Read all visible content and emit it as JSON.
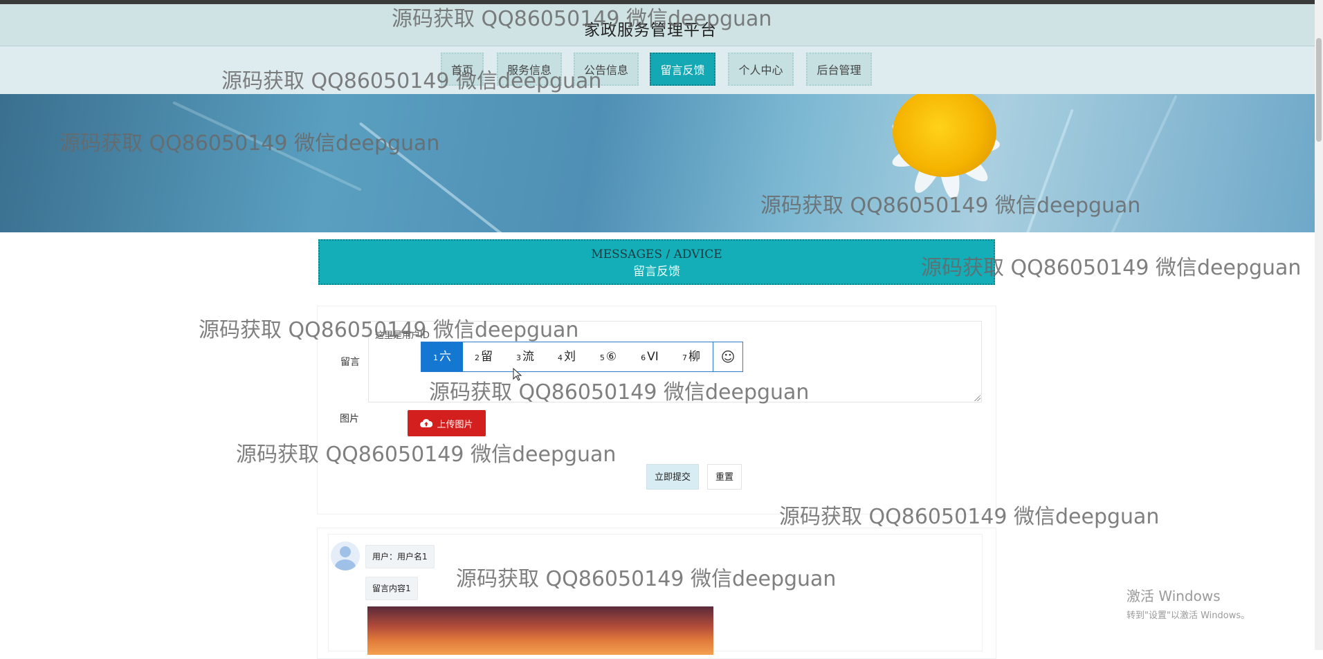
{
  "header": {
    "site_title": "家政服务管理平台"
  },
  "nav": {
    "items": [
      {
        "label": "首页"
      },
      {
        "label": "服务信息"
      },
      {
        "label": "公告信息"
      },
      {
        "label": "留言反馈"
      },
      {
        "label": "个人中心"
      },
      {
        "label": "后台管理"
      }
    ],
    "active": "留言反馈"
  },
  "section": {
    "title_en": "MESSAGES / ADVICE",
    "title_cn": "留言反馈"
  },
  "form": {
    "message_label": "留言",
    "message_placeholder": "这里是用户ID",
    "image_label": "图片",
    "upload_label": "上传图片",
    "submit_label": "立即提交",
    "reset_label": "重置"
  },
  "ime": {
    "candidates": [
      {
        "num": "1",
        "text": "六"
      },
      {
        "num": "2",
        "text": "留"
      },
      {
        "num": "3",
        "text": "流"
      },
      {
        "num": "4",
        "text": "刘"
      },
      {
        "num": "5",
        "text": "⑥"
      },
      {
        "num": "6",
        "text": "VI"
      },
      {
        "num": "7",
        "text": "柳"
      }
    ],
    "emoji_icon": "☺"
  },
  "messages": [
    {
      "user": "用户：用户名1",
      "content": "留言内容1"
    }
  ],
  "watermark_text": "源码获取 QQ86050149 微信deepguan",
  "activation": {
    "line1": "激活 Windows",
    "line2": "转到\"设置\"以激活 Windows。"
  },
  "colors": {
    "accent": "#13aeb8",
    "upload": "#d41f1f",
    "ime_selected": "#1478d2"
  }
}
